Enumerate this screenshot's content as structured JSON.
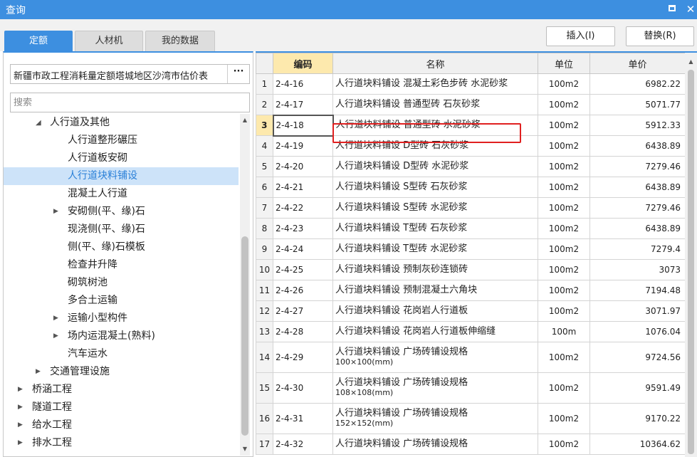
{
  "window": {
    "title": "查询"
  },
  "tabs": [
    {
      "label": "定额",
      "active": true
    },
    {
      "label": "人材机",
      "active": false
    },
    {
      "label": "我的数据",
      "active": false
    }
  ],
  "toolbar": {
    "insert_label": "插入(I)",
    "replace_label": "替换(R)"
  },
  "left": {
    "library": "新疆市政工程消耗量定额塔城地区沙湾市估价表",
    "more_label": "···",
    "search_placeholder": "搜索",
    "tree": [
      {
        "label": "人行道及其他",
        "depth": 1,
        "state": "expanded",
        "selected": false
      },
      {
        "label": "人行道整形碾压",
        "depth": 2,
        "state": "leaf",
        "selected": false
      },
      {
        "label": "人行道板安砌",
        "depth": 2,
        "state": "leaf",
        "selected": false
      },
      {
        "label": "人行道块料铺设",
        "depth": 2,
        "state": "leaf",
        "selected": true
      },
      {
        "label": "混凝土人行道",
        "depth": 2,
        "state": "leaf",
        "selected": false
      },
      {
        "label": "安砌侧(平、缘)石",
        "depth": 2,
        "state": "collapsed",
        "selected": false
      },
      {
        "label": "现浇侧(平、缘)石",
        "depth": 2,
        "state": "leaf",
        "selected": false
      },
      {
        "label": "侧(平、缘)石模板",
        "depth": 2,
        "state": "leaf",
        "selected": false
      },
      {
        "label": "检查井升降",
        "depth": 2,
        "state": "leaf",
        "selected": false
      },
      {
        "label": "砌筑树池",
        "depth": 2,
        "state": "leaf",
        "selected": false
      },
      {
        "label": "多合土运输",
        "depth": 2,
        "state": "leaf",
        "selected": false
      },
      {
        "label": "运输小型构件",
        "depth": 2,
        "state": "collapsed",
        "selected": false
      },
      {
        "label": "场内运混凝土(熟料)",
        "depth": 2,
        "state": "collapsed",
        "selected": false
      },
      {
        "label": "汽车运水",
        "depth": 2,
        "state": "leaf",
        "selected": false
      },
      {
        "label": "交通管理设施",
        "depth": 1,
        "state": "collapsed",
        "selected": false
      },
      {
        "label": "桥涵工程",
        "depth": 0,
        "state": "collapsed",
        "selected": false
      },
      {
        "label": "隧道工程",
        "depth": 0,
        "state": "collapsed",
        "selected": false
      },
      {
        "label": "给水工程",
        "depth": 0,
        "state": "collapsed",
        "selected": false
      },
      {
        "label": "排水工程",
        "depth": 0,
        "state": "collapsed",
        "selected": false
      }
    ]
  },
  "grid": {
    "headers": {
      "code": "编码",
      "name": "名称",
      "unit": "单位",
      "price": "单价"
    },
    "current_row": 3,
    "rows": [
      {
        "no": "1",
        "code": "2-4-16",
        "name": "人行道块料铺设 混凝土彩色步砖 水泥砂浆",
        "sub": "",
        "unit": "100m2",
        "price": "6982.22"
      },
      {
        "no": "2",
        "code": "2-4-17",
        "name": "人行道块料铺设 普通型砖 石灰砂浆",
        "sub": "",
        "unit": "100m2",
        "price": "5071.77"
      },
      {
        "no": "3",
        "code": "2-4-18",
        "name": "人行道块料铺设 普通型砖 水泥砂浆",
        "sub": "",
        "unit": "100m2",
        "price": "5912.33"
      },
      {
        "no": "4",
        "code": "2-4-19",
        "name": "人行道块料铺设 D型砖 石灰砂浆",
        "sub": "",
        "unit": "100m2",
        "price": "6438.89"
      },
      {
        "no": "5",
        "code": "2-4-20",
        "name": "人行道块料铺设 D型砖 水泥砂浆",
        "sub": "",
        "unit": "100m2",
        "price": "7279.46"
      },
      {
        "no": "6",
        "code": "2-4-21",
        "name": "人行道块料铺设 S型砖 石灰砂浆",
        "sub": "",
        "unit": "100m2",
        "price": "6438.89"
      },
      {
        "no": "7",
        "code": "2-4-22",
        "name": "人行道块料铺设 S型砖 水泥砂浆",
        "sub": "",
        "unit": "100m2",
        "price": "7279.46"
      },
      {
        "no": "8",
        "code": "2-4-23",
        "name": "人行道块料铺设 T型砖 石灰砂浆",
        "sub": "",
        "unit": "100m2",
        "price": "6438.89"
      },
      {
        "no": "9",
        "code": "2-4-24",
        "name": "人行道块料铺设 T型砖 水泥砂浆",
        "sub": "",
        "unit": "100m2",
        "price": "7279.4"
      },
      {
        "no": "10",
        "code": "2-4-25",
        "name": "人行道块料铺设 预制灰砂连锁砖",
        "sub": "",
        "unit": "100m2",
        "price": "3073"
      },
      {
        "no": "11",
        "code": "2-4-26",
        "name": "人行道块料铺设 预制混凝土六角块",
        "sub": "",
        "unit": "100m2",
        "price": "7194.48"
      },
      {
        "no": "12",
        "code": "2-4-27",
        "name": "人行道块料铺设 花岗岩人行道板",
        "sub": "",
        "unit": "100m2",
        "price": "3071.97"
      },
      {
        "no": "13",
        "code": "2-4-28",
        "name": "人行道块料铺设 花岗岩人行道板伸缩缝",
        "sub": "",
        "unit": "100m",
        "price": "1076.04"
      },
      {
        "no": "14",
        "code": "2-4-29",
        "name": "人行道块料铺设 广场砖铺设规格",
        "sub": "100×100(mm)",
        "unit": "100m2",
        "price": "9724.56"
      },
      {
        "no": "15",
        "code": "2-4-30",
        "name": "人行道块料铺设 广场砖铺设规格",
        "sub": "108×108(mm)",
        "unit": "100m2",
        "price": "9591.49"
      },
      {
        "no": "16",
        "code": "2-4-31",
        "name": "人行道块料铺设 广场砖铺设规格",
        "sub": "152×152(mm)",
        "unit": "100m2",
        "price": "9170.22"
      },
      {
        "no": "17",
        "code": "2-4-32",
        "name": "人行道块料铺设 广场砖铺设规格",
        "sub": "",
        "unit": "100m2",
        "price": "10364.62"
      }
    ]
  }
}
